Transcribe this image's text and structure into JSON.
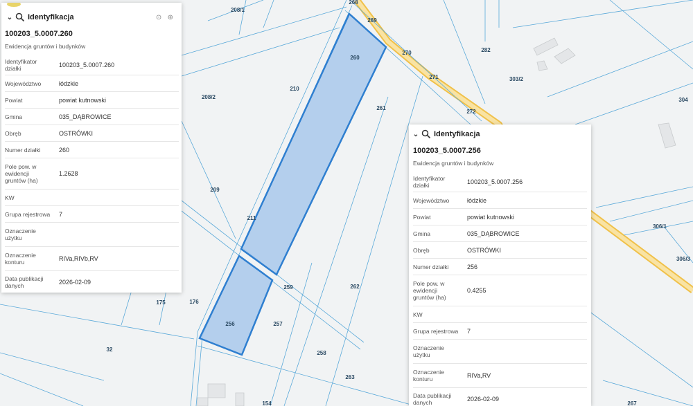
{
  "map": {
    "parcels": [
      {
        "id": "208/1",
        "label": "208/1"
      },
      {
        "id": "268",
        "label": "268"
      },
      {
        "id": "269",
        "label": "269"
      },
      {
        "id": "270",
        "label": "270"
      },
      {
        "id": "282",
        "label": "282"
      },
      {
        "id": "260",
        "label": "260"
      },
      {
        "id": "271",
        "label": "271"
      },
      {
        "id": "303/2",
        "label": "303/2"
      },
      {
        "id": "210",
        "label": "210"
      },
      {
        "id": "208/2",
        "label": "208/2"
      },
      {
        "id": "304",
        "label": "304"
      },
      {
        "id": "261",
        "label": "261"
      },
      {
        "id": "272",
        "label": "272"
      },
      {
        "id": "209",
        "label": "209"
      },
      {
        "id": "211",
        "label": "211"
      },
      {
        "id": "306/1",
        "label": "306/1"
      },
      {
        "id": "306/3",
        "label": "306/3"
      },
      {
        "id": "259",
        "label": "259"
      },
      {
        "id": "262",
        "label": "262"
      },
      {
        "id": "175",
        "label": "175"
      },
      {
        "id": "176",
        "label": "176"
      },
      {
        "id": "256",
        "label": "256"
      },
      {
        "id": "257",
        "label": "257"
      },
      {
        "id": "32",
        "label": "32"
      },
      {
        "id": "258",
        "label": "258"
      },
      {
        "id": "263",
        "label": "263"
      },
      {
        "id": "154",
        "label": "154"
      },
      {
        "id": "267",
        "label": "267"
      }
    ],
    "colors": {
      "highlight_fill": "#a9c8eb",
      "highlight_stroke": "#2f7fd0",
      "road": "#f4cf63",
      "boundary": "#5aa9d9"
    }
  },
  "panel1": {
    "title": "Identyfikacja",
    "id": "100203_5.0007.260",
    "subtitle": "Ewidencja gruntów i budynków",
    "rows": [
      {
        "k1": "Identyfikator",
        "k2": "działki",
        "v": "100203_5.0007.260"
      },
      {
        "k1": "Województwo",
        "k2": "",
        "v": "łódzkie"
      },
      {
        "k1": "Powiat",
        "k2": "",
        "v": "powiat kutnowski"
      },
      {
        "k1": "Gmina",
        "k2": "",
        "v": "035_DĄBROWICE"
      },
      {
        "k1": "Obręb",
        "k2": "",
        "v": "OSTRÓWKI"
      },
      {
        "k1": "Numer działki",
        "k2": "",
        "v": "260"
      },
      {
        "k1": "Pole pow. w",
        "k2": "ewidencji",
        "k3": "gruntów (ha)",
        "v": "1.2628"
      },
      {
        "k1": "KW",
        "k2": "",
        "v": ""
      },
      {
        "k1": "Grupa rejestrowa",
        "k2": "",
        "v": "7"
      },
      {
        "k1": "Oznaczenie",
        "k2": "użytku",
        "v": ""
      },
      {
        "k1": "Oznaczenie",
        "k2": "konturu",
        "v": "RIVa,RIVb,RV"
      },
      {
        "k1": "Data publikacji",
        "k2": "danych",
        "v": "2026-02-09"
      }
    ]
  },
  "panel2": {
    "title": "Identyfikacja",
    "id": "100203_5.0007.256",
    "subtitle": "Ewidencja gruntów i budynków",
    "rows": [
      {
        "k1": "Identyfikator",
        "k2": "działki",
        "v": "100203_5.0007.256"
      },
      {
        "k1": "Województwo",
        "k2": "",
        "v": "łódzkie"
      },
      {
        "k1": "Powiat",
        "k2": "",
        "v": "powiat kutnowski"
      },
      {
        "k1": "Gmina",
        "k2": "",
        "v": "035_DĄBROWICE"
      },
      {
        "k1": "Obręb",
        "k2": "",
        "v": "OSTRÓWKI"
      },
      {
        "k1": "Numer działki",
        "k2": "",
        "v": "256"
      },
      {
        "k1": "Pole pow. w",
        "k2": "ewidencji",
        "k3": "gruntów (ha)",
        "v": "0.4255"
      },
      {
        "k1": "KW",
        "k2": "",
        "v": ""
      },
      {
        "k1": "Grupa rejestrowa",
        "k2": "",
        "v": "7"
      },
      {
        "k1": "Oznaczenie",
        "k2": "użytku",
        "v": ""
      },
      {
        "k1": "Oznaczenie",
        "k2": "konturu",
        "v": "RIVa,RV"
      },
      {
        "k1": "Data publikacji",
        "k2": "danych",
        "v": "2026-02-09"
      }
    ]
  }
}
